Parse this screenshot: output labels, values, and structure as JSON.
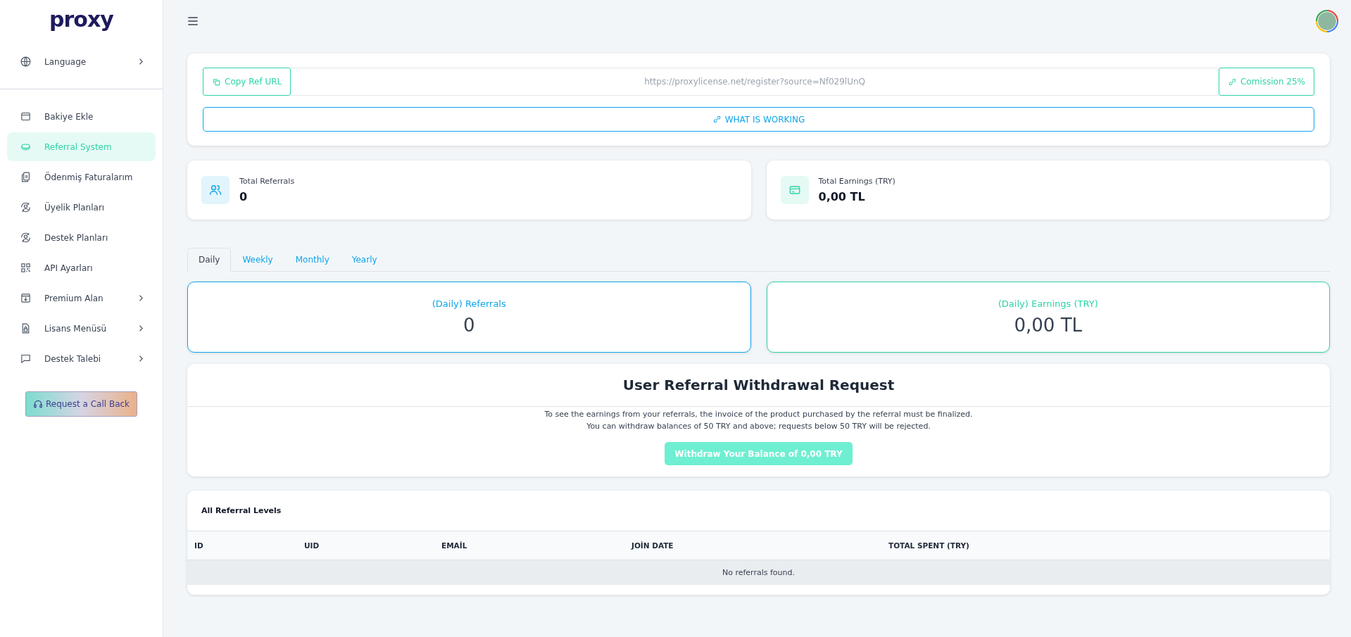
{
  "logo": "proxy",
  "sidebar": {
    "top_item": {
      "label": "Language",
      "expandable": true
    },
    "items": [
      {
        "label": "Bakiye Ekle",
        "selected": false,
        "expandable": false
      },
      {
        "label": "Referral System",
        "selected": true,
        "expandable": false
      },
      {
        "label": "Ödenmiş Faturalarım",
        "selected": false,
        "expandable": false
      },
      {
        "label": "Üyelik Planları",
        "selected": false,
        "expandable": false
      },
      {
        "label": "Destek Planları",
        "selected": false,
        "expandable": false
      },
      {
        "label": "API Ayarları",
        "selected": false,
        "expandable": false
      },
      {
        "label": "Premium Alan",
        "selected": false,
        "expandable": true
      },
      {
        "label": "Lisans Menüsü",
        "selected": false,
        "expandable": true
      },
      {
        "label": "Destek Talebi",
        "selected": false,
        "expandable": true
      }
    ],
    "callback_button": "Request a Call Back"
  },
  "ref": {
    "copy_button": "Copy Ref URL",
    "url": "https://proxylicense.net/register?source=Nf029lUnQ",
    "commission": "Comission 25%",
    "info_button": "WHAT IS WORKING"
  },
  "totals": [
    {
      "label": "Total Referrals",
      "value": "0",
      "color": "#0ea5e9"
    },
    {
      "label": "Total Earnings (TRY)",
      "value": "0,00 TL",
      "color": "#2dd4a8"
    }
  ],
  "tabs": [
    {
      "label": "Daily",
      "selected": true
    },
    {
      "label": "Weekly",
      "selected": false
    },
    {
      "label": "Monthly",
      "selected": false
    },
    {
      "label": "Yearly",
      "selected": false
    }
  ],
  "period_stats": [
    {
      "label": "(Daily) Referrals",
      "value": "0",
      "color": "#0ea5e9"
    },
    {
      "label": "(Daily) Earnings (TRY)",
      "value": "0,00 TL",
      "color": "#2dd4a8"
    }
  ],
  "withdrawal": {
    "title": "User Referral Withdrawal Request",
    "lines": [
      "To see the earnings from your referrals, the invoice of the product purchased by the referral must be finalized.",
      "You can withdraw balances of 50 TRY and above; requests below 50 TRY will be rejected."
    ],
    "button": "Withdraw Your Balance of 0,00 TRY"
  },
  "table": {
    "title": "All Referral Levels",
    "columns": [
      "ID",
      "UID",
      "EMAİL",
      "JOİN DATE",
      "TOTAL SPENT (TRY)"
    ],
    "empty_message": "No referrals found."
  }
}
